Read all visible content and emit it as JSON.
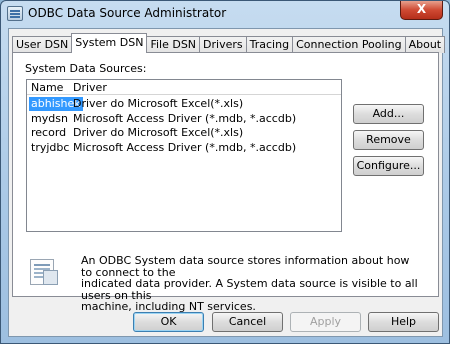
{
  "window": {
    "title": "ODBC Data Source Administrator",
    "close_glyph": "X"
  },
  "tabs": [
    "User DSN",
    "System DSN",
    "File DSN",
    "Drivers",
    "Tracing",
    "Connection Pooling",
    "About"
  ],
  "active_tab": "System DSN",
  "section_label": "System Data Sources:",
  "columns": {
    "name": "Name",
    "driver": "Driver"
  },
  "rows": [
    {
      "name": "abhishek",
      "driver": "Driver do Microsoft Excel(*.xls)",
      "selected": true
    },
    {
      "name": "mydsn",
      "driver": "Microsoft Access Driver (*.mdb, *.accdb)",
      "selected": false
    },
    {
      "name": "record",
      "driver": "Driver do Microsoft Excel(*.xls)",
      "selected": false
    },
    {
      "name": "tryjdbc",
      "driver": "Microsoft Access Driver (*.mdb, *.accdb)",
      "selected": false
    }
  ],
  "side_buttons": {
    "add": "Add...",
    "remove": "Remove",
    "configure": "Configure..."
  },
  "info": {
    "icon": "database-document-icon",
    "line1": "An ODBC System data source stores information about how to connect to the",
    "line2": "indicated data provider.   A System data source is visible to all users on this",
    "line3": "machine, including NT services."
  },
  "footer": {
    "ok": "OK",
    "cancel": "Cancel",
    "apply": "Apply",
    "help": "Help"
  }
}
